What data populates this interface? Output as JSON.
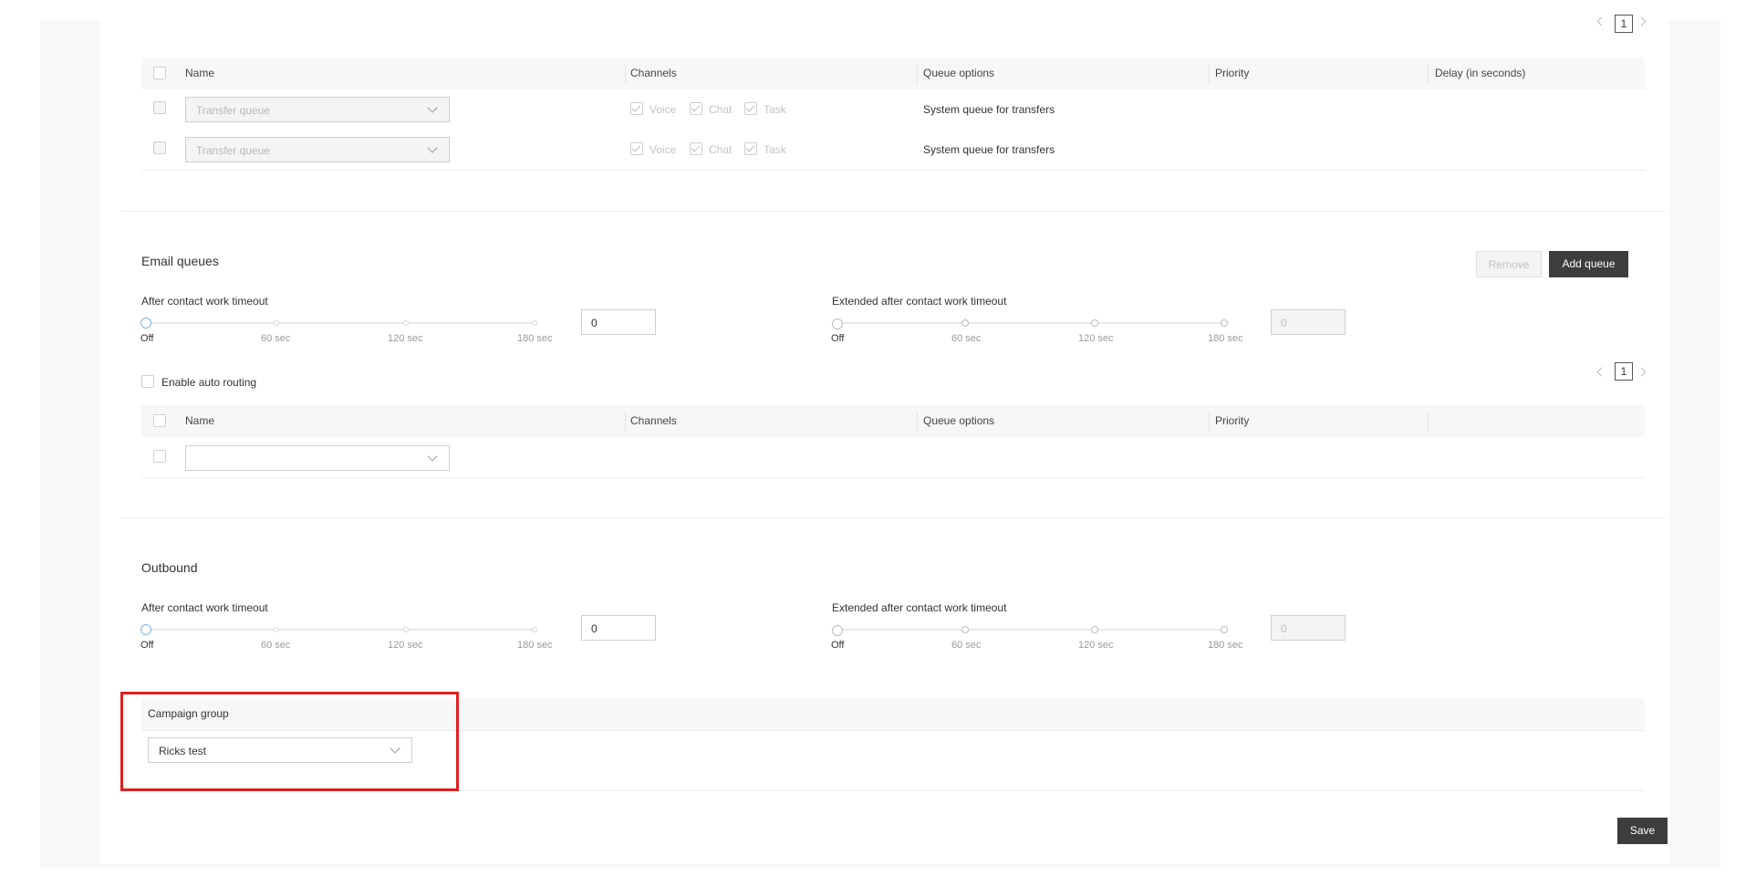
{
  "transfer_table": {
    "pager_current": "1",
    "headers": {
      "name": "Name",
      "channels": "Channels",
      "queue_options": "Queue options",
      "priority": "Priority",
      "delay": "Delay (in seconds)"
    },
    "rows": [
      {
        "name": "Transfer queue",
        "channels": [
          "Voice",
          "Chat",
          "Task"
        ],
        "queue_options": "System queue for transfers"
      },
      {
        "name": "Transfer queue",
        "channels": [
          "Voice",
          "Chat",
          "Task"
        ],
        "queue_options": "System queue for transfers"
      }
    ]
  },
  "email_queues": {
    "title": "Email queues",
    "remove_label": "Remove",
    "add_queue_label": "Add queue",
    "acw": {
      "label": "After contact work timeout",
      "ticks": [
        "Off",
        "60 sec",
        "120 sec",
        "180 sec"
      ],
      "value": "0"
    },
    "ext_acw": {
      "label": "Extended after contact work timeout",
      "ticks": [
        "Off",
        "60 sec",
        "120 sec",
        "180 sec"
      ],
      "value": "0"
    },
    "auto_routing_label": "Enable auto routing",
    "pager_current": "1",
    "headers": {
      "name": "Name",
      "channels": "Channels",
      "queue_options": "Queue options",
      "priority": "Priority"
    }
  },
  "outbound": {
    "title": "Outbound",
    "acw": {
      "label": "After contact work timeout",
      "ticks": [
        "Off",
        "60 sec",
        "120 sec",
        "180 sec"
      ],
      "value": "0"
    },
    "ext_acw": {
      "label": "Extended after contact work timeout",
      "ticks": [
        "Off",
        "60 sec",
        "120 sec",
        "180 sec"
      ],
      "value": "0"
    },
    "campaign_group_label": "Campaign group",
    "campaign_group_value": "Ricks test"
  },
  "save_label": "Save",
  "colors": {
    "highlight": "#e02020",
    "dark_button": "#3d3d3d",
    "active_handle": "#7fb3e6"
  }
}
